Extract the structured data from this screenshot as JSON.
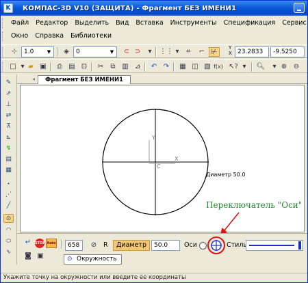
{
  "window": {
    "title": "КОМПАС-3D V10 (ЗАЩИТА) - Фрагмент БЕЗ ИМЕНИ1"
  },
  "menu": {
    "row1": [
      "Файл",
      "Редактор",
      "Выделить",
      "Вид",
      "Вставка",
      "Инструменты",
      "Спецификация",
      "Сервис"
    ],
    "row2": [
      "Окно",
      "Справка",
      "Библиотеки"
    ]
  },
  "toolbar1": {
    "line_scale": "1.0",
    "layer": "0",
    "y_label": "Y",
    "x_label": "X",
    "x_coord": "23.2833",
    "y_coord": "-9.5250"
  },
  "doc_tab": {
    "label": "Фрагмент БЕЗ ИМЕНИ1"
  },
  "drawing": {
    "diameter_label": "Диаметр 50.0",
    "y_axis_label": "Y",
    "x_axis_label": "X",
    "center_label": "C"
  },
  "annotation": {
    "text": "Переключатель \"Оси\""
  },
  "props_panel": {
    "stop_label": "STOP",
    "auto_label": "Auto",
    "coord_value": "658",
    "r_label": "R",
    "diameter_field_label": "Диаметр",
    "diameter_value": "50.0",
    "axes_label": "Оси",
    "style_label": "Стиль",
    "tab_label": "Окружность"
  },
  "status": {
    "text": "Укажите точку на окружности или введите ее координаты"
  },
  "colors": {
    "title_bar": "#0447c8",
    "annotation": "#1c8a2c",
    "arrow": "#e01010",
    "highlight_ring": "#e01010",
    "axes_button": "#1a2fd0"
  }
}
